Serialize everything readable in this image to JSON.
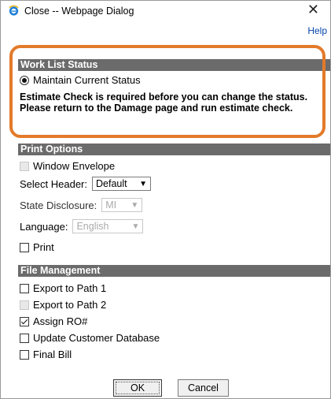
{
  "window": {
    "title": "Close -- Webpage Dialog",
    "close_glyph": "✕",
    "help": "Help"
  },
  "work_list_status": {
    "header": "Work List Status",
    "option": "Maintain Current Status",
    "message": "Estimate Check is required before you can change the status. Please return to the Damage page and run estimate check."
  },
  "print_options": {
    "header": "Print Options",
    "window_envelope": "Window Envelope",
    "select_header_label": "Select Header:",
    "select_header_value": "Default",
    "state_disclosure_label": "State Disclosure:",
    "state_disclosure_value": "MI",
    "language_label": "Language:",
    "language_value": "English",
    "print": "Print"
  },
  "file_management": {
    "header": "File Management",
    "export1": "Export to Path 1",
    "export2": "Export to Path 2",
    "assign_ro": "Assign RO#",
    "update_customer_db": "Update Customer Database",
    "final_bill": "Final Bill"
  },
  "buttons": {
    "ok": "OK",
    "cancel": "Cancel"
  },
  "colors": {
    "section_header_bg": "#6b6b6b",
    "highlight": "#e37a2a",
    "link": "#0645ad"
  },
  "icons": {
    "app": "ie-icon",
    "close": "close-icon",
    "dropdown": "chevron-down-icon"
  }
}
